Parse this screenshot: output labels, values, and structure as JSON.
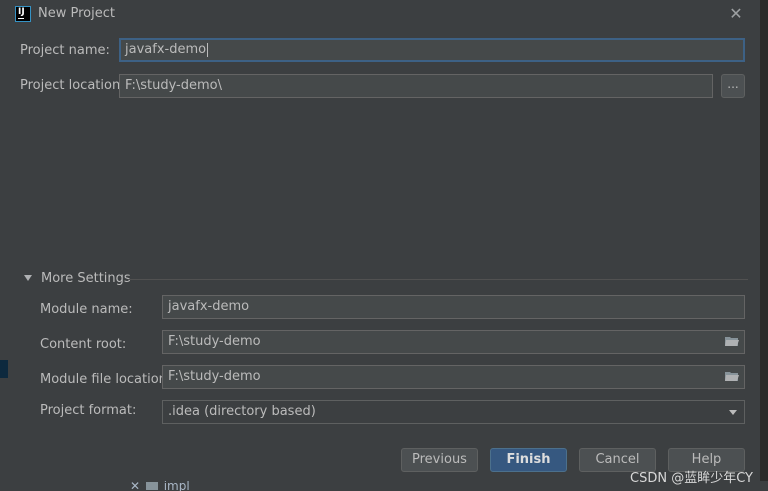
{
  "window": {
    "title": "New Project",
    "icon": "intellij-idea-icon"
  },
  "form": {
    "project_name_label": "Project name:",
    "project_name_value": "javafx-demo",
    "project_location_label": "Project location:",
    "project_location_value": "F:\\study-demo\\",
    "browse_label": "..."
  },
  "more_settings": {
    "header": "More Settings",
    "module_name_label": "Module name:",
    "module_name_value": "javafx-demo",
    "content_root_label": "Content root:",
    "content_root_value": "F:\\study-demo",
    "module_file_location_label": "Module file location:",
    "module_file_location_value": "F:\\study-demo",
    "project_format_label": "Project format:",
    "project_format_value": ".idea (directory based)"
  },
  "buttons": {
    "previous": "Previous",
    "finish": "Finish",
    "cancel": "Cancel",
    "help": "Help"
  },
  "background": {
    "tree_item": "impl"
  },
  "watermark": "CSDN @蓝眸少年CY",
  "colors": {
    "dialog_bg": "#3c3f41",
    "field_bg": "#45494a",
    "focus_border": "#3d6185",
    "primary_button": "#365880"
  }
}
